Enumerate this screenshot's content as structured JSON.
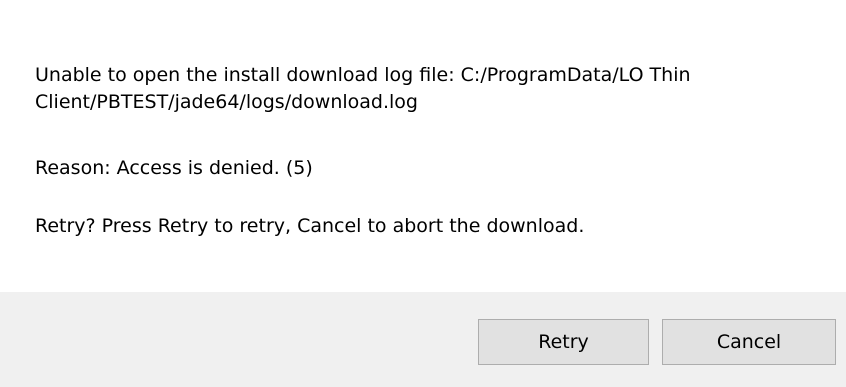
{
  "dialog": {
    "message_line1": "Unable to open the install download log file: C:/ProgramData/LO Thin",
    "message_line2": "Client/PBTEST/jade64/logs/download.log",
    "reason": "Reason: Access is denied. (5)",
    "retry_prompt": "Retry? Press Retry to retry, Cancel to abort the download.",
    "buttons": {
      "retry_label": "Retry",
      "cancel_label": "Cancel"
    }
  }
}
